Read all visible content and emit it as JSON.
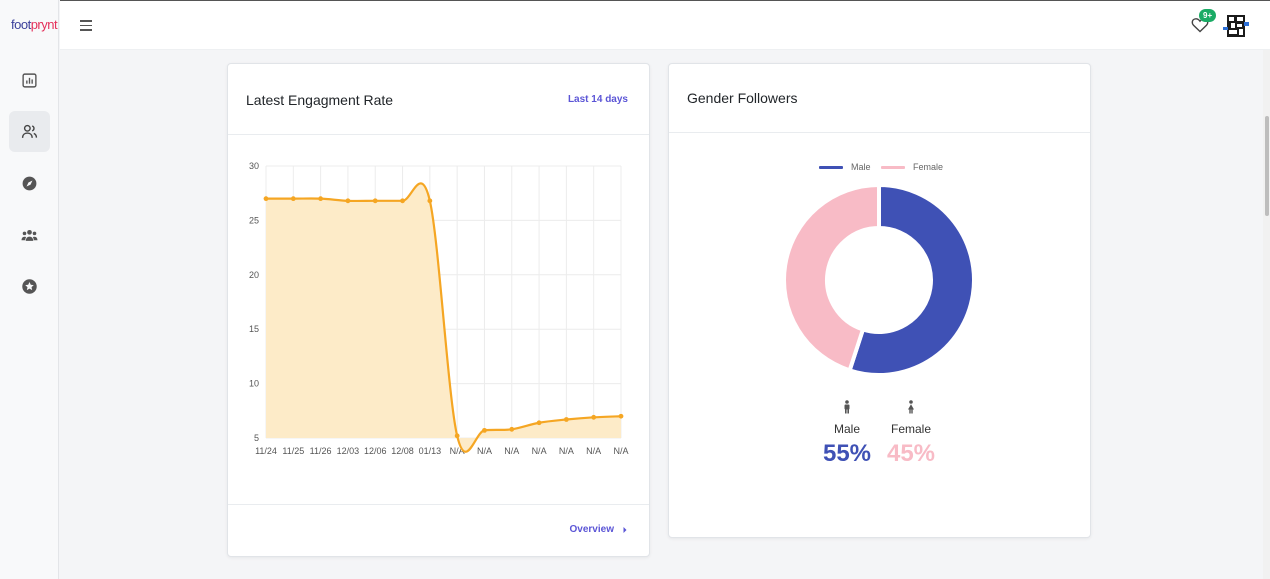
{
  "app": {
    "logo_part1": "foot",
    "logo_part2": "prynt"
  },
  "sidebar": {
    "items": [
      {
        "icon": "bar-chart-icon",
        "active": false
      },
      {
        "icon": "users-icon",
        "active": true
      },
      {
        "icon": "compass-icon",
        "active": false
      },
      {
        "icon": "group-icon",
        "active": false
      },
      {
        "icon": "star-icon",
        "active": false
      }
    ]
  },
  "topbar": {
    "notification_badge": "9+"
  },
  "engagement_card": {
    "title": "Latest Engagment Rate",
    "range_link": "Last 14 days",
    "footer_link": "Overview"
  },
  "gender_card": {
    "title": "Gender Followers",
    "male_label": "Male",
    "female_label": "Female",
    "male_pct": "55%",
    "female_pct": "45%",
    "male_color": "#3f51b5",
    "female_color": "#f8bbc6"
  },
  "chart_data": [
    {
      "type": "area",
      "categories": [
        "11/24",
        "11/25",
        "11/26",
        "12/03",
        "12/06",
        "12/08",
        "01/13",
        "N/A",
        "N/A",
        "N/A",
        "N/A",
        "N/A",
        "N/A",
        "N/A"
      ],
      "y_ticks": [
        5,
        10,
        15,
        20,
        25,
        30
      ],
      "series": [
        {
          "values": [
            27.0,
            27.0,
            27.0,
            26.8,
            26.8,
            26.8,
            26.8,
            5.2,
            5.7,
            5.8,
            6.4,
            6.7,
            6.9,
            7.0
          ]
        }
      ],
      "ylim": [
        5,
        30
      ],
      "grid": true,
      "line_color": "#f5a623",
      "fill_color": "#fdebc8"
    },
    {
      "type": "pie",
      "categories": [
        "Male",
        "Female"
      ],
      "values": [
        55,
        45
      ],
      "legend": "top",
      "colors": [
        "#3f51b5",
        "#f8bbc6"
      ]
    }
  ]
}
